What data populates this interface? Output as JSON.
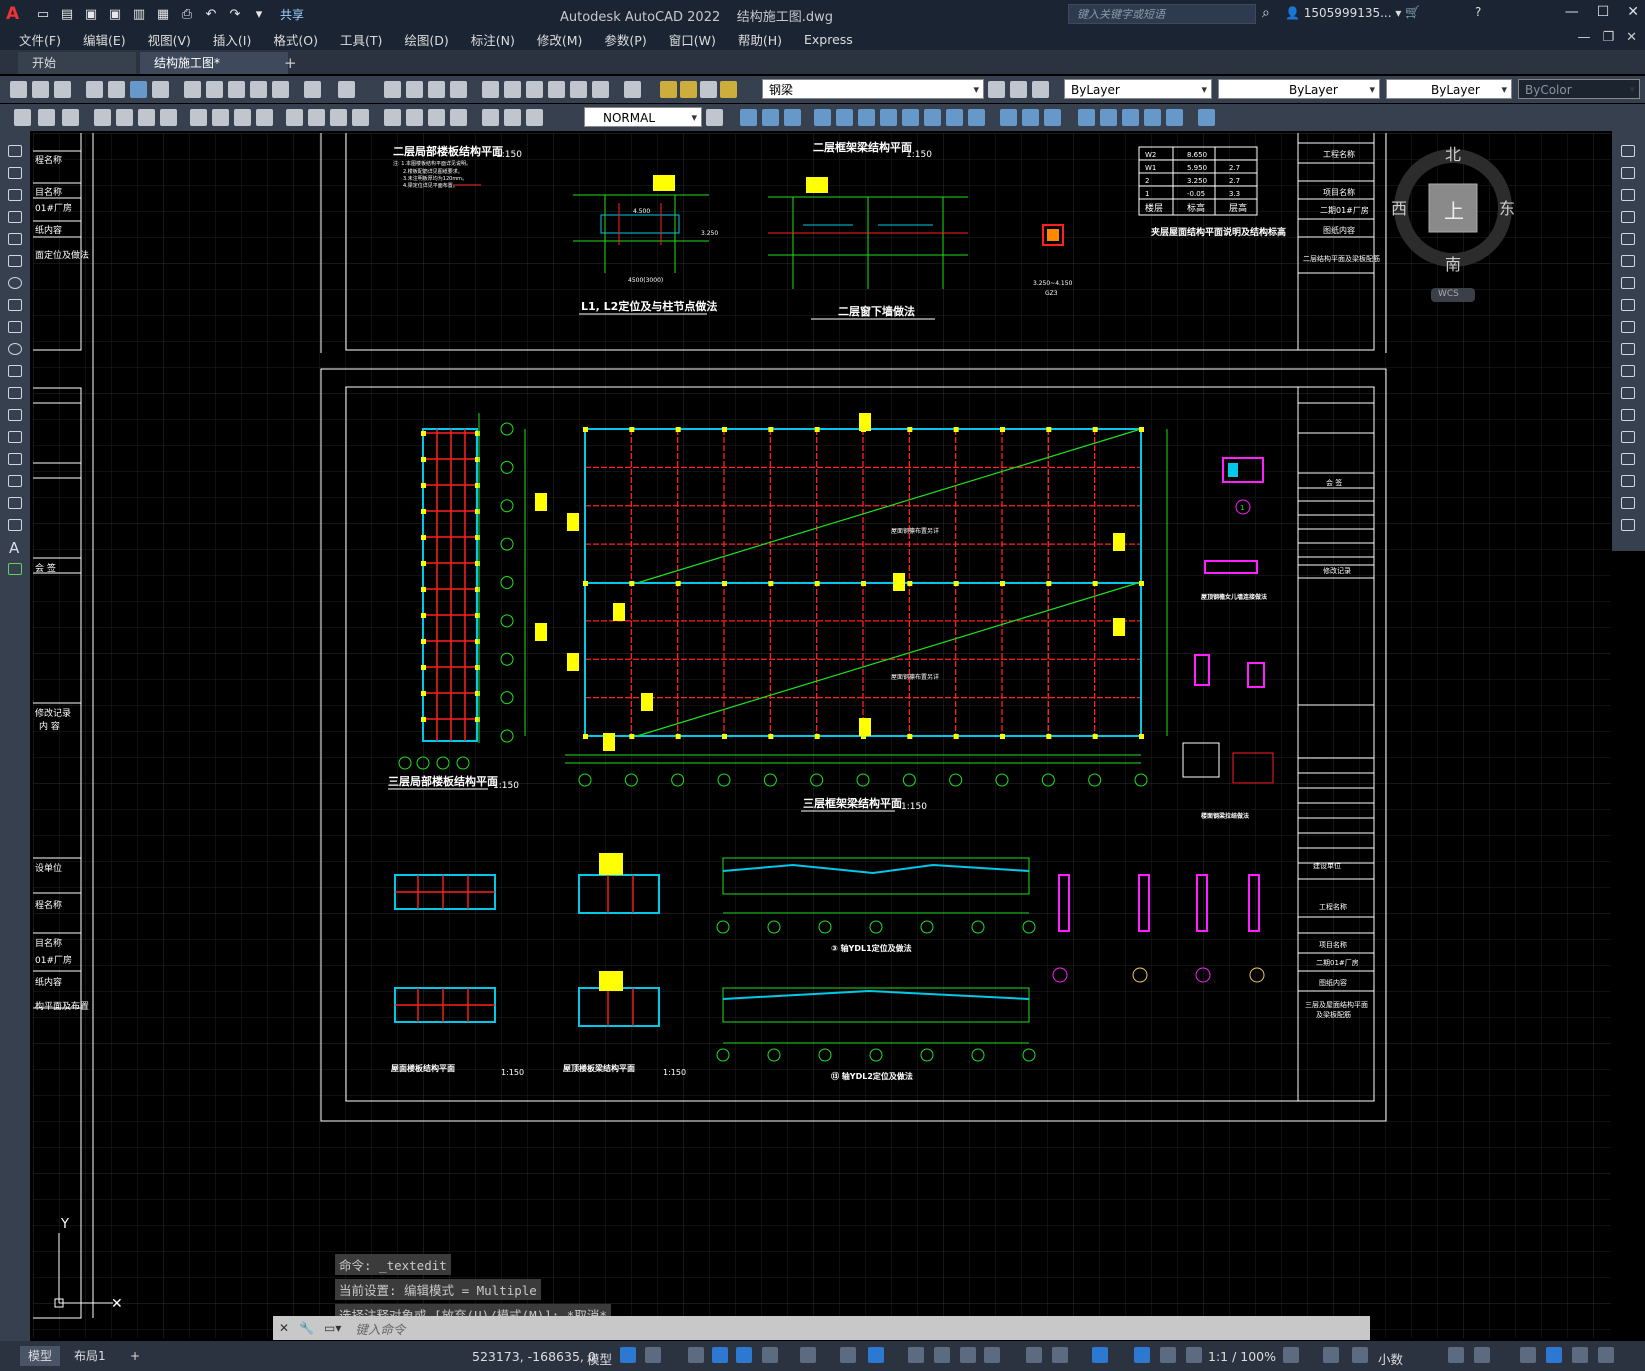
{
  "app": {
    "title": "Autodesk AutoCAD 2022",
    "filename": "结构施工图.dwg",
    "search_placeholder": "键入关键字或短语",
    "user": "1505999135...",
    "share": "共享"
  },
  "menu": [
    "文件(F)",
    "编辑(E)",
    "视图(V)",
    "插入(I)",
    "格式(O)",
    "工具(T)",
    "绘图(D)",
    "标注(N)",
    "修改(M)",
    "参数(P)",
    "窗口(W)",
    "帮助(H)",
    "Express"
  ],
  "tabs": {
    "start": "开始",
    "active": "结构施工图*"
  },
  "toolbar": {
    "layer": "钢梁",
    "color": "ByLayer",
    "linetype": "ByLayer",
    "lineweight": "ByLayer",
    "plotstyle": "ByColor",
    "dimstyle": "NORMAL"
  },
  "viewcube": {
    "north": "北",
    "south": "南",
    "east": "东",
    "west": "西",
    "top": "上",
    "wcs": "WCS"
  },
  "drawing": {
    "titles": [
      "二层局部楼板结构平面",
      "二层框架梁结构平面",
      "L1, L2定位及与柱节点做法",
      "二层窗下墙做法",
      "屋面层结构平面说明及结构标高",
      "三层局部楼板结构平面",
      "三层框架梁结构平面",
      "屋面楼板结构平面",
      "屋顶楼板梁结构平面",
      "轴YDL1定位及做法",
      "轴YDL2定位及做法",
      "屋面钢檩条布置详图"
    ],
    "scale": "1:150",
    "level_table": {
      "headers": [
        "楼层",
        "标高",
        "层高"
      ],
      "rows": [
        [
          "W2",
          "8.650",
          ""
        ],
        [
          "W1",
          "5.950",
          "2.7"
        ],
        [
          "2",
          "3.250",
          "2.7"
        ],
        [
          "1",
          "-0.05",
          "3.3"
        ]
      ]
    },
    "title_block": {
      "project_label": "工程名称",
      "item_label": "项目名称",
      "item_value": "二期01#厂房",
      "content_label": "图纸内容",
      "content_value": "二层结构平面及梁板配筋",
      "content_value_2": "三层及屋面结构平面及梁板配筋",
      "revision": "修改记录",
      "design_unit": "建设单位",
      "sign": "会 签"
    }
  },
  "command_history": [
    "命令: _textedit",
    "当前设置: 编辑模式 = Multiple",
    "选择注释对象或 [放弃(U)/模式(M)]: *取消*"
  ],
  "command_placeholder": "键入命令",
  "status": {
    "tabs": [
      "模型",
      "布局1"
    ],
    "coords": "523173, -168635, 0",
    "model": "模型",
    "scale": "1:1 / 100%",
    "units": "小数"
  },
  "colors": {
    "background": "#000000",
    "red": "#ff2020",
    "cyan": "#00c8e8",
    "yellow": "#ffff00",
    "green": "#20e020",
    "magenta": "#ff20ff"
  }
}
